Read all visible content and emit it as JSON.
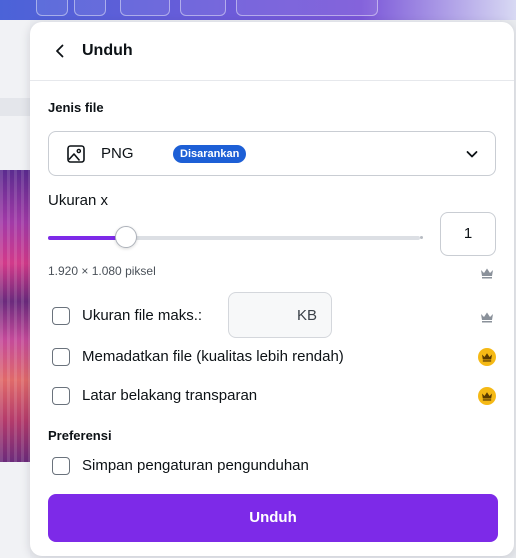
{
  "panel": {
    "title": "Unduh",
    "file_type": {
      "label": "Jenis file",
      "value": "PNG",
      "badge": "Disarankan"
    },
    "size": {
      "label": "Ukuran x",
      "value": "1",
      "slider_fraction": 0.21,
      "dimensions": "1.920 × 1.080 piksel"
    },
    "options": {
      "max_file_size": {
        "label": "Ukuran file maks.:",
        "unit": "KB",
        "checked": false
      },
      "compress": {
        "label": "Memadatkan file (kualitas lebih rendah)",
        "checked": false
      },
      "transparent": {
        "label": "Latar belakang transparan",
        "checked": false
      }
    },
    "preferences": {
      "label": "Preferensi",
      "save_settings": {
        "label": "Simpan pengaturan pengunduhan",
        "checked": false
      }
    },
    "download_button": "Unduh"
  },
  "colors": {
    "accent": "#7d2ae8",
    "badge": "#1d5fd6",
    "premium_crown": "#f5b915"
  },
  "icons": {
    "back": "chevron-left-icon",
    "file_type": "image-icon",
    "dropdown": "chevron-down-icon",
    "premium": "crown-icon"
  }
}
